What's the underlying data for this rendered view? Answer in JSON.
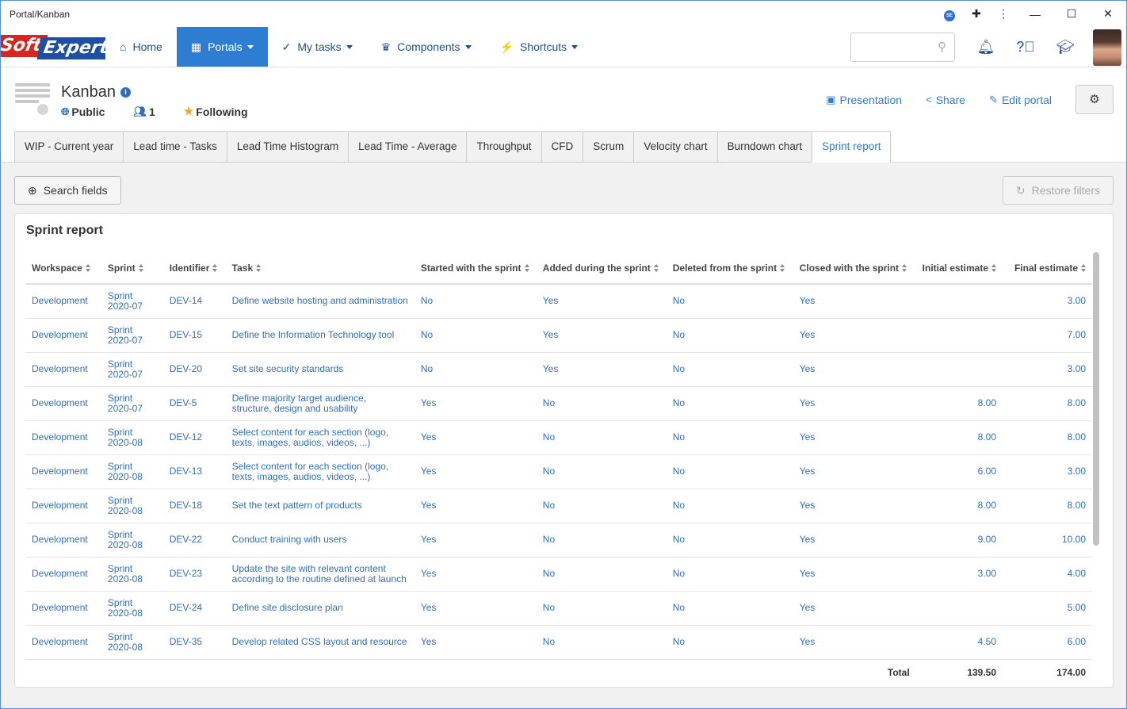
{
  "window": {
    "title": "Portal/Kanban",
    "ext_badge": "SE"
  },
  "nav": {
    "items": [
      {
        "label": "Home",
        "icon": "home-icon"
      },
      {
        "label": "Portals",
        "icon": "portals-icon"
      },
      {
        "label": "My tasks",
        "icon": "check-icon"
      },
      {
        "label": "Components",
        "icon": "trophy-icon"
      },
      {
        "label": "Shortcuts",
        "icon": "bolt-icon"
      }
    ],
    "search_placeholder": "",
    "logo_part1": "Soft",
    "logo_part2": "Expert"
  },
  "portal": {
    "title": "Kanban",
    "visibility": "Public",
    "members": "1",
    "following": "Following",
    "actions": {
      "presentation": "Presentation",
      "share": "Share",
      "edit": "Edit portal"
    }
  },
  "tabs": [
    "WIP - Current year",
    "Lead time - Tasks",
    "Lead Time Histogram",
    "Lead Time - Average",
    "Throughput",
    "CFD",
    "Scrum",
    "Velocity chart",
    "Burndown chart",
    "Sprint report"
  ],
  "buttons": {
    "search_fields": "Search fields",
    "restore_filters": "Restore filters"
  },
  "report": {
    "title": "Sprint report",
    "columns": [
      "Workspace",
      "Sprint",
      "Identifier",
      "Task",
      "Started with the sprint",
      "Added during the sprint",
      "Deleted from the sprint",
      "Closed with the sprint",
      "Initial estimate",
      "Final estimate"
    ],
    "rows": [
      {
        "workspace": "Development",
        "sprint": "Sprint 2020-07",
        "id": "DEV-14",
        "task": "Define website hosting and administration",
        "started": "No",
        "added": "Yes",
        "deleted": "No",
        "closed": "Yes",
        "initial": "",
        "final": "3.00"
      },
      {
        "workspace": "Development",
        "sprint": "Sprint 2020-07",
        "id": "DEV-15",
        "task": "Define the Information Technology tool",
        "started": "No",
        "added": "Yes",
        "deleted": "No",
        "closed": "Yes",
        "initial": "",
        "final": "7.00"
      },
      {
        "workspace": "Development",
        "sprint": "Sprint 2020-07",
        "id": "DEV-20",
        "task": "Set site security standards",
        "started": "No",
        "added": "Yes",
        "deleted": "No",
        "closed": "Yes",
        "initial": "",
        "final": "3.00"
      },
      {
        "workspace": "Development",
        "sprint": "Sprint 2020-07",
        "id": "DEV-5",
        "task": "Define majority target audience, structure, design and usability",
        "started": "Yes",
        "added": "No",
        "deleted": "No",
        "closed": "Yes",
        "initial": "8.00",
        "final": "8.00"
      },
      {
        "workspace": "Development",
        "sprint": "Sprint 2020-08",
        "id": "DEV-12",
        "task": "Select content for each section (logo, texts, images, audios, videos, ...)",
        "started": "Yes",
        "added": "No",
        "deleted": "No",
        "closed": "Yes",
        "initial": "8.00",
        "final": "8.00"
      },
      {
        "workspace": "Development",
        "sprint": "Sprint 2020-08",
        "id": "DEV-13",
        "task": "Select content for each section (logo, texts, images, audios, videos, ...)",
        "started": "Yes",
        "added": "No",
        "deleted": "No",
        "closed": "Yes",
        "initial": "6.00",
        "final": "3.00"
      },
      {
        "workspace": "Development",
        "sprint": "Sprint 2020-08",
        "id": "DEV-18",
        "task": "Set the text pattern of products",
        "started": "Yes",
        "added": "No",
        "deleted": "No",
        "closed": "Yes",
        "initial": "8.00",
        "final": "8.00"
      },
      {
        "workspace": "Development",
        "sprint": "Sprint 2020-08",
        "id": "DEV-22",
        "task": "Conduct training with users",
        "started": "Yes",
        "added": "No",
        "deleted": "No",
        "closed": "Yes",
        "initial": "9.00",
        "final": "10.00"
      },
      {
        "workspace": "Development",
        "sprint": "Sprint 2020-08",
        "id": "DEV-23",
        "task": "Update the site with relevant content according to the routine defined at launch",
        "started": "Yes",
        "added": "No",
        "deleted": "No",
        "closed": "Yes",
        "initial": "3.00",
        "final": "4.00"
      },
      {
        "workspace": "Development",
        "sprint": "Sprint 2020-08",
        "id": "DEV-24",
        "task": "Define site disclosure plan",
        "started": "Yes",
        "added": "No",
        "deleted": "No",
        "closed": "Yes",
        "initial": "",
        "final": "5.00"
      },
      {
        "workspace": "Development",
        "sprint": "Sprint 2020-08",
        "id": "DEV-35",
        "task": "Develop related CSS layout and resource",
        "started": "Yes",
        "added": "No",
        "deleted": "No",
        "closed": "Yes",
        "initial": "4.50",
        "final": "6.00"
      }
    ],
    "total": {
      "label": "Total",
      "initial": "139.50",
      "final": "174.00"
    }
  }
}
